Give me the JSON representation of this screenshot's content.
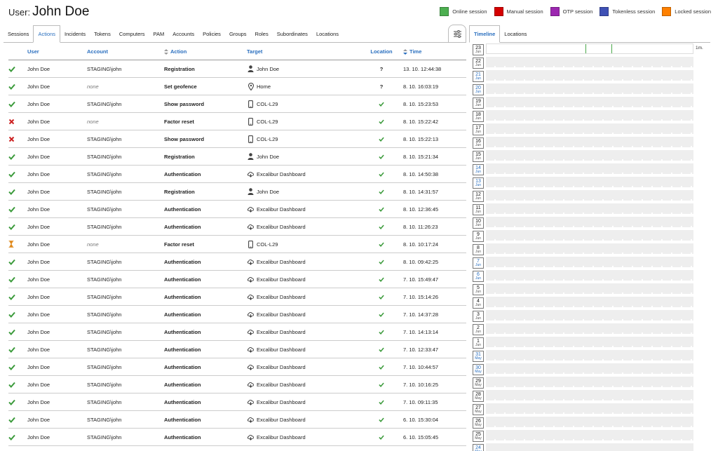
{
  "header": {
    "prefix": "User:",
    "name": "John Doe"
  },
  "legend": [
    {
      "label": "Online session",
      "color": "#4caf50"
    },
    {
      "label": "Manual session",
      "color": "#d50000"
    },
    {
      "label": "OTP session",
      "color": "#9c27b0"
    },
    {
      "label": "Tokenless session",
      "color": "#3f51b5"
    },
    {
      "label": "Locked session",
      "color": "#ff8000"
    }
  ],
  "tabs": [
    {
      "label": "Sessions",
      "active": false
    },
    {
      "label": "Actions",
      "active": true
    },
    {
      "label": "Incidents",
      "active": false
    },
    {
      "label": "Tokens",
      "active": false
    },
    {
      "label": "Computers",
      "active": false
    },
    {
      "label": "PAM",
      "active": false
    },
    {
      "label": "Accounts",
      "active": false
    },
    {
      "label": "Policies",
      "active": false
    },
    {
      "label": "Groups",
      "active": false
    },
    {
      "label": "Roles",
      "active": false
    },
    {
      "label": "Subordinates",
      "active": false
    },
    {
      "label": "Locations",
      "active": false
    }
  ],
  "columns": {
    "user": "User",
    "account": "Account",
    "action": "Action",
    "target": "Target",
    "location": "Location",
    "time": "Time"
  },
  "rows": [
    {
      "status": "check",
      "user": "John Doe",
      "account": "STAGING\\john",
      "action": "Registration",
      "target_icon": "person-icon",
      "target": "John Doe",
      "location": "?",
      "time": "13. 10. 12:44:38"
    },
    {
      "status": "check",
      "user": "John Doe",
      "account": "none",
      "action": "Set geofence",
      "target_icon": "pin-icon",
      "target": "Home",
      "location": "?",
      "time": "8. 10. 16:03:19"
    },
    {
      "status": "check",
      "user": "John Doe",
      "account": "STAGING\\john",
      "action": "Show password",
      "target_icon": "phone-icon",
      "target": "COL-L29",
      "location": "check",
      "time": "8. 10. 15:23:53"
    },
    {
      "status": "cross",
      "user": "John Doe",
      "account": "none",
      "action": "Factor reset",
      "target_icon": "phone-icon",
      "target": "COL-L29",
      "location": "check",
      "time": "8. 10. 15:22:42"
    },
    {
      "status": "cross",
      "user": "John Doe",
      "account": "STAGING\\john",
      "action": "Show password",
      "target_icon": "phone-icon",
      "target": "COL-L29",
      "location": "check",
      "time": "8. 10. 15:22:13"
    },
    {
      "status": "check",
      "user": "John Doe",
      "account": "STAGING\\john",
      "action": "Registration",
      "target_icon": "person-icon",
      "target": "John Doe",
      "location": "check",
      "time": "8. 10. 15:21:34"
    },
    {
      "status": "check",
      "user": "John Doe",
      "account": "STAGING\\john",
      "action": "Authentication",
      "target_icon": "cloud-icon",
      "target": "Excalibur Dashboard",
      "location": "check",
      "time": "8. 10. 14:50:38"
    },
    {
      "status": "check",
      "user": "John Doe",
      "account": "STAGING\\john",
      "action": "Registration",
      "target_icon": "person-icon",
      "target": "John Doe",
      "location": "check",
      "time": "8. 10. 14:31:57"
    },
    {
      "status": "check",
      "user": "John Doe",
      "account": "STAGING\\john",
      "action": "Authentication",
      "target_icon": "cloud-icon",
      "target": "Excalibur Dashboard",
      "location": "check",
      "time": "8. 10. 12:36:45"
    },
    {
      "status": "check",
      "user": "John Doe",
      "account": "STAGING\\john",
      "action": "Authentication",
      "target_icon": "cloud-icon",
      "target": "Excalibur Dashboard",
      "location": "check",
      "time": "8. 10. 11:26:23"
    },
    {
      "status": "hourglass",
      "user": "John Doe",
      "account": "none",
      "action": "Factor reset",
      "target_icon": "phone-icon",
      "target": "COL-L29",
      "location": "check",
      "time": "8. 10. 10:17:24"
    },
    {
      "status": "check",
      "user": "John Doe",
      "account": "STAGING\\john",
      "action": "Authentication",
      "target_icon": "cloud-icon",
      "target": "Excalibur Dashboard",
      "location": "check",
      "time": "8. 10. 09:42:25"
    },
    {
      "status": "check",
      "user": "John Doe",
      "account": "STAGING\\john",
      "action": "Authentication",
      "target_icon": "cloud-icon",
      "target": "Excalibur Dashboard",
      "location": "check",
      "time": "7. 10. 15:49:47"
    },
    {
      "status": "check",
      "user": "John Doe",
      "account": "STAGING\\john",
      "action": "Authentication",
      "target_icon": "cloud-icon",
      "target": "Excalibur Dashboard",
      "location": "check",
      "time": "7. 10. 15:14:26"
    },
    {
      "status": "check",
      "user": "John Doe",
      "account": "STAGING\\john",
      "action": "Authentication",
      "target_icon": "cloud-icon",
      "target": "Excalibur Dashboard",
      "location": "check",
      "time": "7. 10. 14:37:28"
    },
    {
      "status": "check",
      "user": "John Doe",
      "account": "STAGING\\john",
      "action": "Authentication",
      "target_icon": "cloud-icon",
      "target": "Excalibur Dashboard",
      "location": "check",
      "time": "7. 10. 14:13:14"
    },
    {
      "status": "check",
      "user": "John Doe",
      "account": "STAGING\\john",
      "action": "Authentication",
      "target_icon": "cloud-icon",
      "target": "Excalibur Dashboard",
      "location": "check",
      "time": "7. 10. 12:33:47"
    },
    {
      "status": "check",
      "user": "John Doe",
      "account": "STAGING\\john",
      "action": "Authentication",
      "target_icon": "cloud-icon",
      "target": "Excalibur Dashboard",
      "location": "check",
      "time": "7. 10. 10:44:57"
    },
    {
      "status": "check",
      "user": "John Doe",
      "account": "STAGING\\john",
      "action": "Authentication",
      "target_icon": "cloud-icon",
      "target": "Excalibur Dashboard",
      "location": "check",
      "time": "7. 10. 10:16:25"
    },
    {
      "status": "check",
      "user": "John Doe",
      "account": "STAGING\\john",
      "action": "Authentication",
      "target_icon": "cloud-icon",
      "target": "Excalibur Dashboard",
      "location": "check",
      "time": "7. 10. 09:11:35"
    },
    {
      "status": "check",
      "user": "John Doe",
      "account": "STAGING\\john",
      "action": "Authentication",
      "target_icon": "cloud-icon",
      "target": "Excalibur Dashboard",
      "location": "check",
      "time": "6. 10. 15:30:04"
    },
    {
      "status": "check",
      "user": "John Doe",
      "account": "STAGING\\john",
      "action": "Authentication",
      "target_icon": "cloud-icon",
      "target": "Excalibur Dashboard",
      "location": "check",
      "time": "6. 10. 15:05:45"
    }
  ],
  "right_tabs": [
    {
      "label": "Timeline",
      "active": true
    },
    {
      "label": "Locations",
      "active": false
    }
  ],
  "timeline": {
    "scale_label": "1m.",
    "days": [
      {
        "day": "23",
        "month": "Jun",
        "blue": false
      },
      {
        "day": "22",
        "month": "Jun",
        "blue": false
      },
      {
        "day": "21",
        "month": "Jun",
        "blue": true
      },
      {
        "day": "20",
        "month": "Jun",
        "blue": true
      },
      {
        "day": "19",
        "month": "Jun",
        "blue": false
      },
      {
        "day": "18",
        "month": "Jun",
        "blue": false
      },
      {
        "day": "17",
        "month": "Jun",
        "blue": false
      },
      {
        "day": "16",
        "month": "Jun",
        "blue": false
      },
      {
        "day": "15",
        "month": "Jun",
        "blue": false
      },
      {
        "day": "14",
        "month": "Jun",
        "blue": true
      },
      {
        "day": "13",
        "month": "Jun",
        "blue": true
      },
      {
        "day": "12",
        "month": "Jun",
        "blue": false
      },
      {
        "day": "11",
        "month": "Jun",
        "blue": false
      },
      {
        "day": "10",
        "month": "Jun",
        "blue": false
      },
      {
        "day": "9",
        "month": "Jun",
        "blue": false
      },
      {
        "day": "8",
        "month": "Jun",
        "blue": false
      },
      {
        "day": "7",
        "month": "Jun",
        "blue": true
      },
      {
        "day": "6",
        "month": "Jun",
        "blue": true
      },
      {
        "day": "5",
        "month": "Jun",
        "blue": false
      },
      {
        "day": "4",
        "month": "Jun",
        "blue": false
      },
      {
        "day": "3",
        "month": "Jun",
        "blue": false
      },
      {
        "day": "2",
        "month": "Jun",
        "blue": false
      },
      {
        "day": "1",
        "month": "Jun",
        "blue": false
      },
      {
        "day": "31",
        "month": "May",
        "blue": true
      },
      {
        "day": "30",
        "month": "May",
        "blue": true
      },
      {
        "day": "29",
        "month": "May",
        "blue": false
      },
      {
        "day": "28",
        "month": "May",
        "blue": false
      },
      {
        "day": "27",
        "month": "May",
        "blue": false
      },
      {
        "day": "26",
        "month": "May",
        "blue": false
      },
      {
        "day": "25",
        "month": "May",
        "blue": false
      },
      {
        "day": "24",
        "month": "May",
        "blue": true
      }
    ]
  },
  "colors": {
    "accent": "#2a6fbf",
    "check": "#3a9a3a",
    "cross": "#cc2222",
    "hourglass": "#e08a1e"
  }
}
